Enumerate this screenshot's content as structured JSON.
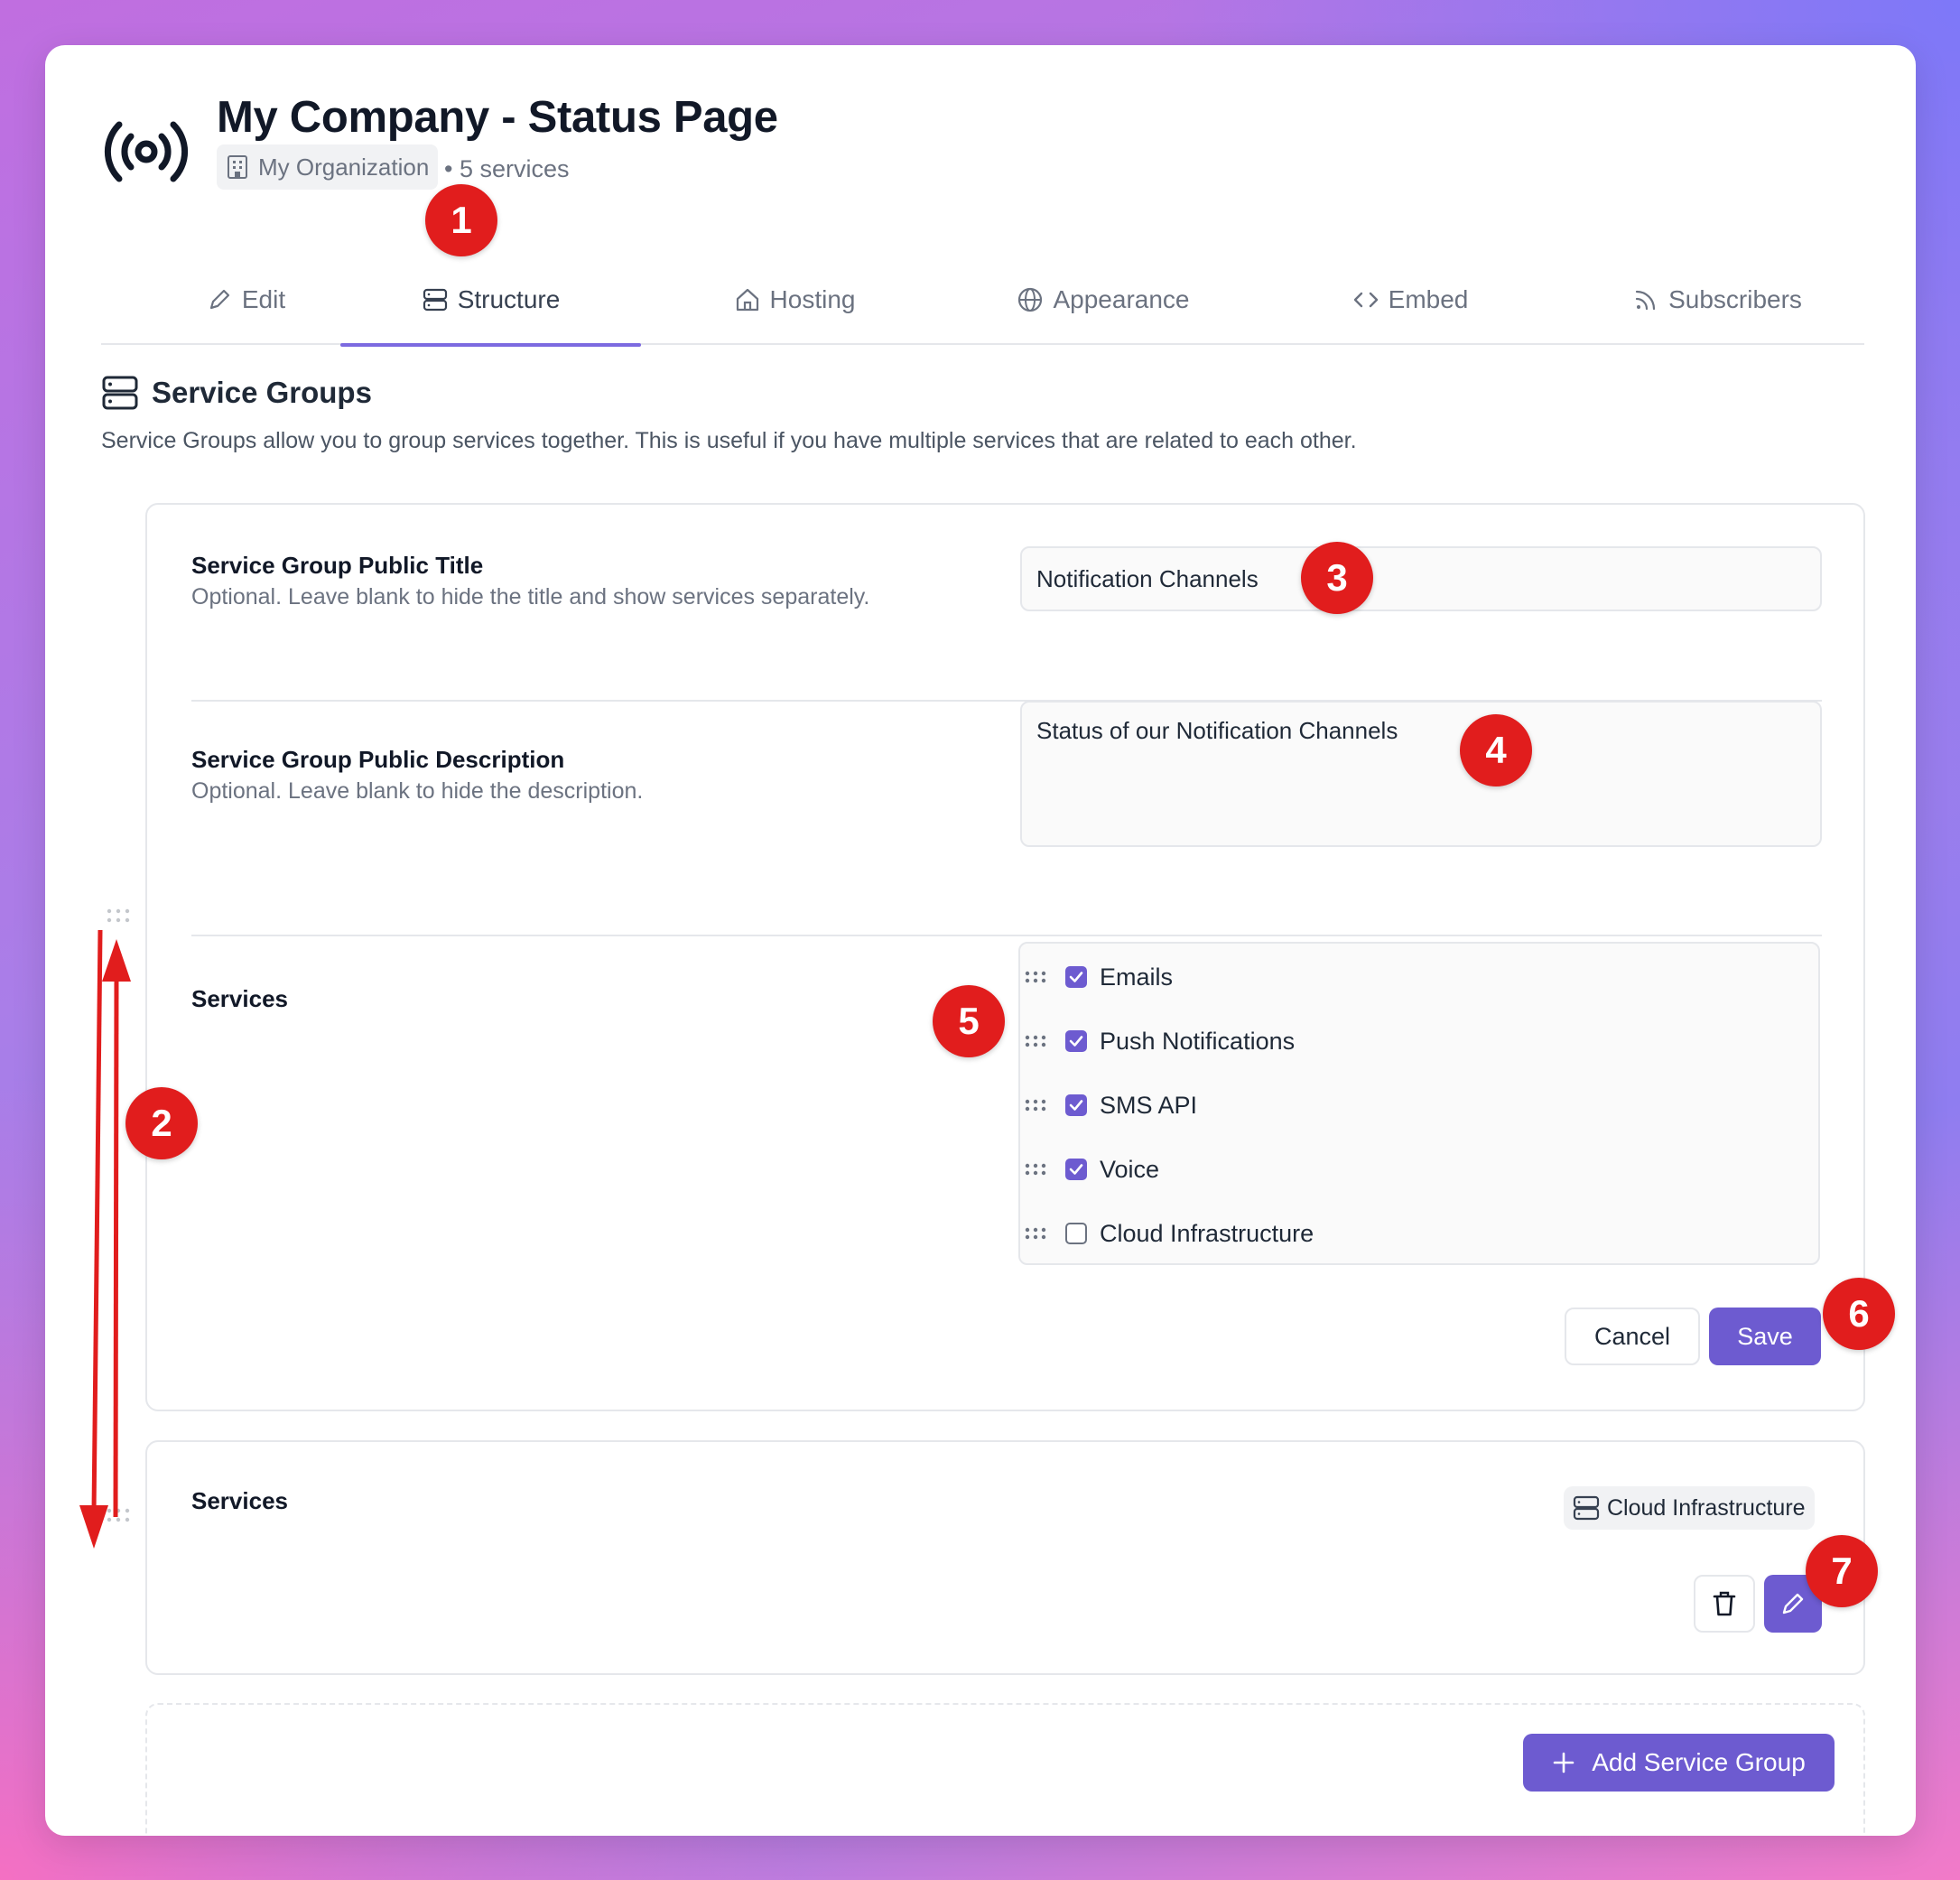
{
  "header": {
    "title": "My Company - Status Page",
    "organization": "My Organization",
    "services_count": "• 5 services"
  },
  "tabs": [
    {
      "label": "Edit",
      "icon": "pencil-icon"
    },
    {
      "label": "Structure",
      "icon": "server-icon",
      "active": true
    },
    {
      "label": "Hosting",
      "icon": "home-icon"
    },
    {
      "label": "Appearance",
      "icon": "globe-icon"
    },
    {
      "label": "Embed",
      "icon": "code-icon"
    },
    {
      "label": "Subscribers",
      "icon": "rss-icon"
    }
  ],
  "section": {
    "title": "Service Groups",
    "description": "Service Groups allow you to group services together. This is useful if you have multiple services that are related to each other."
  },
  "group_editor": {
    "title_label": "Service Group Public Title",
    "title_hint": "Optional. Leave blank to hide the title and show services separately.",
    "title_value": "Notification Channels",
    "description_label": "Service Group Public Description",
    "description_hint": "Optional. Leave blank to hide the description.",
    "description_value": "Status of our Notification Channels",
    "services_label": "Services",
    "services": [
      {
        "name": "Emails",
        "checked": true
      },
      {
        "name": "Push Notifications",
        "checked": true
      },
      {
        "name": "SMS API",
        "checked": true
      },
      {
        "name": "Voice",
        "checked": true
      },
      {
        "name": "Cloud Infrastructure",
        "checked": false
      }
    ],
    "cancel_label": "Cancel",
    "save_label": "Save"
  },
  "group_collapsed": {
    "services_label": "Services",
    "service_chip": "Cloud Infrastructure"
  },
  "add_group_label": "Add Service Group",
  "annotations": [
    "1",
    "2",
    "3",
    "4",
    "5",
    "6",
    "7"
  ],
  "colors": {
    "accent": "#6d5bd0",
    "annotation": "#e11d1d"
  }
}
